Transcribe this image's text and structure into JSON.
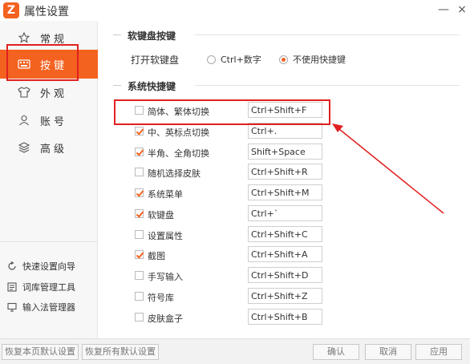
{
  "window": {
    "title": "属性设置",
    "logo_letter": "Z",
    "min_glyph": "—",
    "close_glyph": "×"
  },
  "sidebar": {
    "items": [
      {
        "label": "常规",
        "icon": "star-icon"
      },
      {
        "label": "按键",
        "icon": "keyboard-icon"
      },
      {
        "label": "外观",
        "icon": "tshirt-icon"
      },
      {
        "label": "账号",
        "icon": "user-icon"
      },
      {
        "label": "高级",
        "icon": "layers-icon"
      }
    ],
    "active_index": 1,
    "tools": [
      {
        "label": "快速设置向导",
        "icon": "refresh-icon"
      },
      {
        "label": "词库管理工具",
        "icon": "dictionary-icon"
      },
      {
        "label": "输入法管理器",
        "icon": "monitor-icon"
      }
    ]
  },
  "soft_keyboard": {
    "section_title": "软键盘按键",
    "label": "打开软键盘",
    "options": [
      {
        "label": "Ctrl+数字",
        "checked": false
      },
      {
        "label": "不使用快捷键",
        "checked": true
      }
    ]
  },
  "shortcuts": {
    "section_title": "系统快捷键",
    "rows": [
      {
        "label": "简体、繁体切换",
        "hotkey": "Ctrl+Shift+F",
        "checked": false
      },
      {
        "label": "中、英标点切换",
        "hotkey": "Ctrl+.",
        "checked": true
      },
      {
        "label": "半角、全角切换",
        "hotkey": "Shift+Space",
        "checked": true
      },
      {
        "label": "随机选择皮肤",
        "hotkey": "Ctrl+Shift+R",
        "checked": false
      },
      {
        "label": "系统菜单",
        "hotkey": "Ctrl+Shift+M",
        "checked": true
      },
      {
        "label": "软键盘",
        "hotkey": "Ctrl+`",
        "checked": true
      },
      {
        "label": "设置属性",
        "hotkey": "Ctrl+Shift+C",
        "checked": false
      },
      {
        "label": "截图",
        "hotkey": "Ctrl+Shift+A",
        "checked": true
      },
      {
        "label": "手写输入",
        "hotkey": "Ctrl+Shift+D",
        "checked": false
      },
      {
        "label": "符号库",
        "hotkey": "Ctrl+Shift+Z",
        "checked": false
      },
      {
        "label": "皮肤盒子",
        "hotkey": "Ctrl+Shift+B",
        "checked": false
      }
    ]
  },
  "footer": {
    "restore_page": "恢复本页默认设置",
    "restore_all": "恢复所有默认设置",
    "ok": "确认",
    "cancel": "取消",
    "apply": "应用"
  },
  "colors": {
    "accent": "#f4621f",
    "highlight": "#e02020"
  }
}
